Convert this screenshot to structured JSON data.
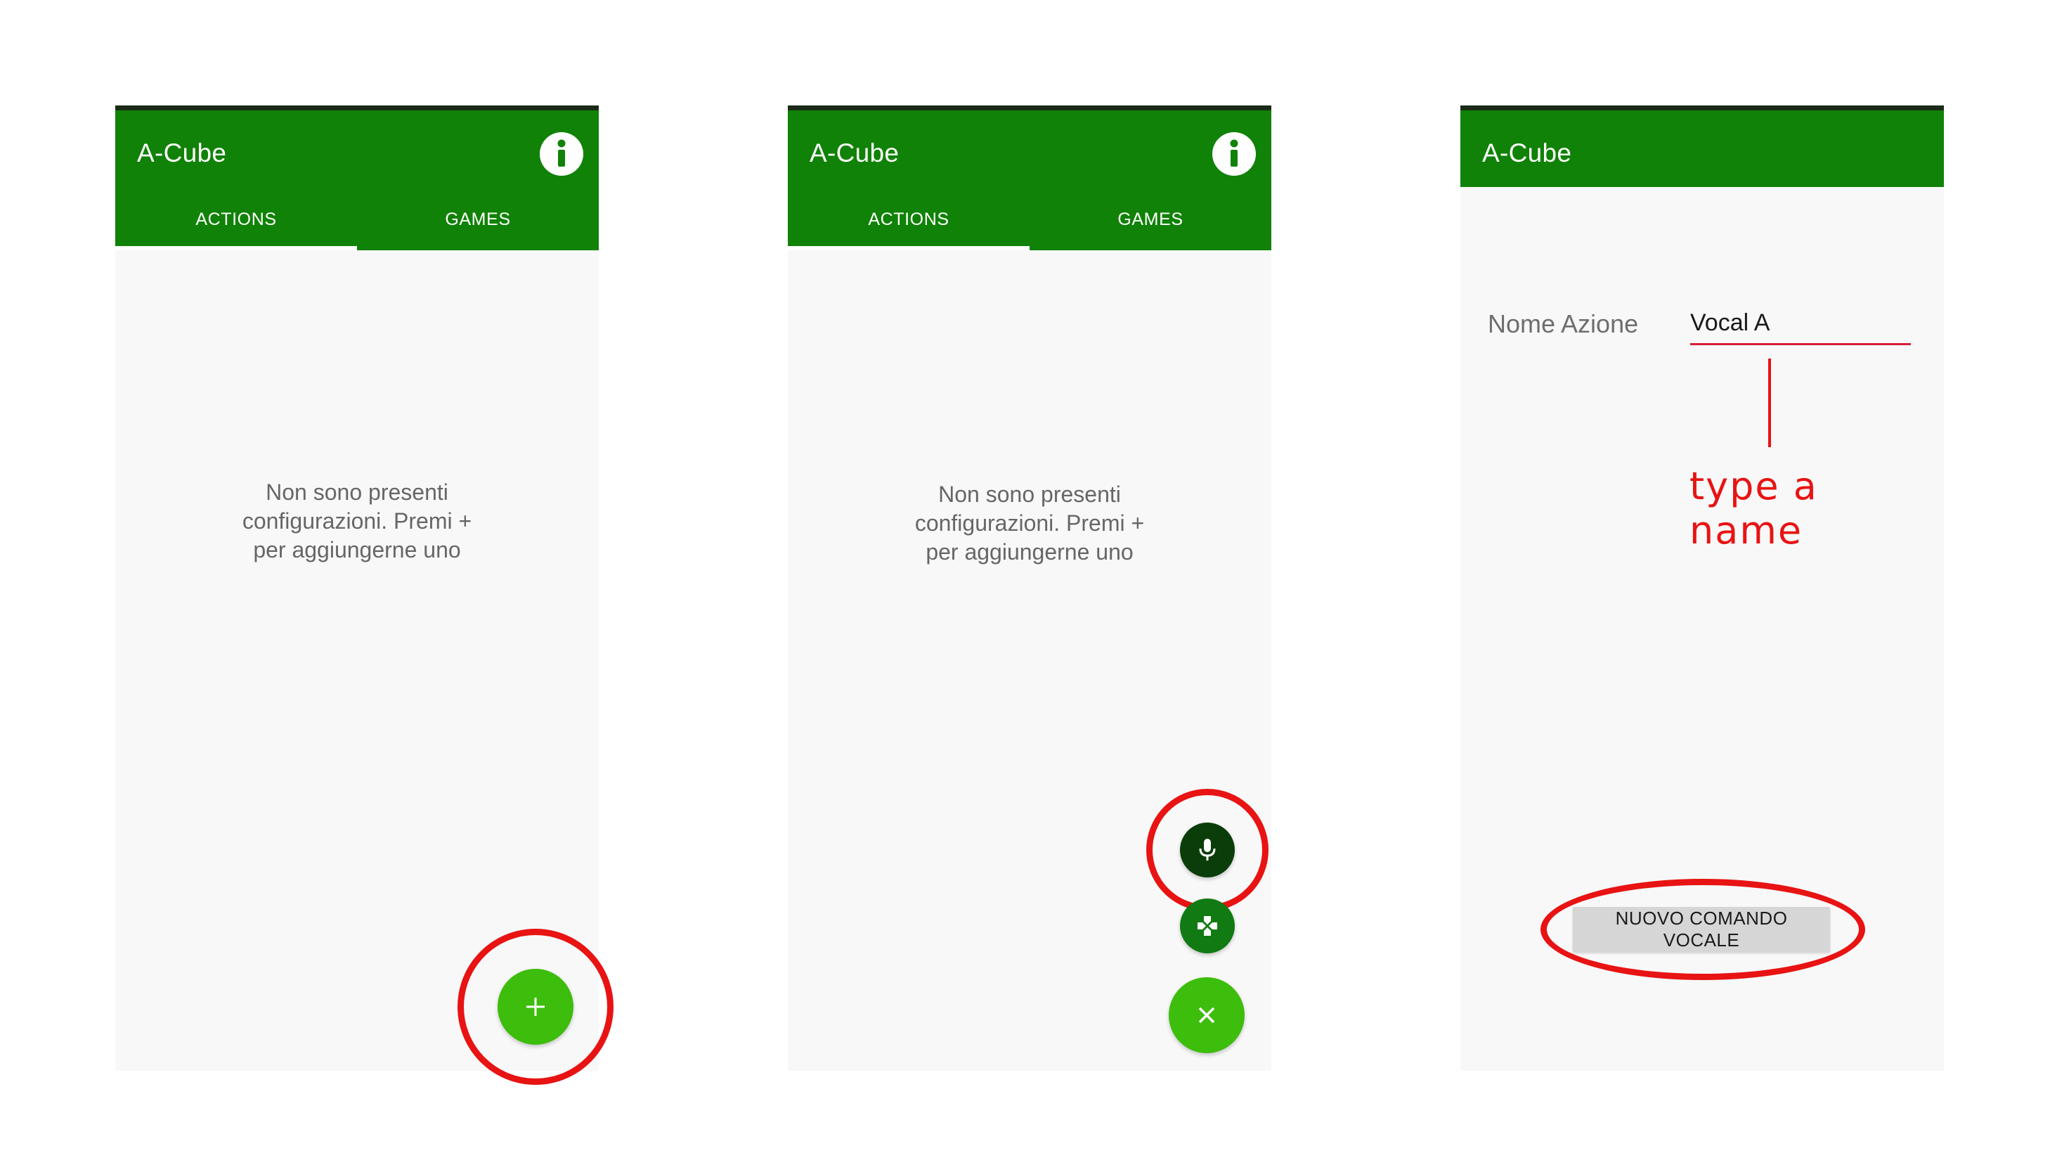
{
  "app": {
    "title": "A-Cube"
  },
  "tabs": [
    {
      "label": "ACTIONS",
      "active": true
    },
    {
      "label": "GAMES",
      "active": false
    }
  ],
  "empty_state": {
    "message": "Non sono presenti\nconfigurazioni. Premi +\nper aggiungerne uno"
  },
  "fab": {
    "add_symbol": "+",
    "close_symbol": "×"
  },
  "form": {
    "label": "Nome Azione",
    "value": "Vocal A",
    "submit_label": "NUOVO COMANDO VOCALE"
  },
  "annotation": {
    "text": "type a name"
  },
  "icons": {
    "info": "info-icon",
    "mic": "microphone-icon",
    "gamepad": "gamepad-icon",
    "plus": "plus-icon",
    "close": "close-icon"
  },
  "colors": {
    "app_bar": "#108207",
    "fab_light": "#3dbd0c",
    "fab_dark": "#0b3d0b",
    "fab_mid": "#117a12",
    "highlight": "#e81313",
    "input_underline": "#d81b3c",
    "background": "#f8f8f8"
  }
}
